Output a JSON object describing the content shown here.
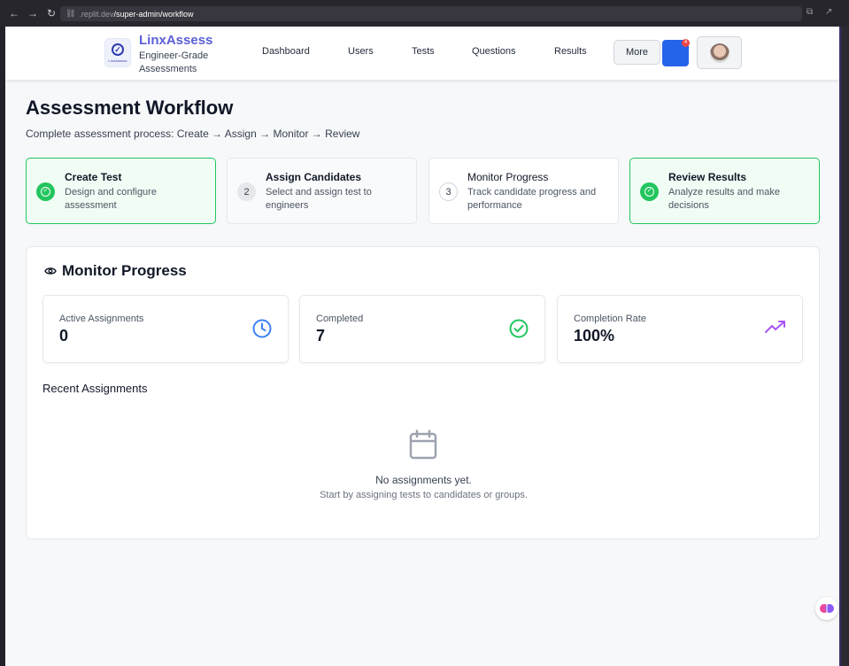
{
  "browser": {
    "url_host": ".replit.dev",
    "url_path": "/super-admin/workflow"
  },
  "header": {
    "brand_name": "LinxAssess",
    "brand_tagline": "Engineer-Grade Assessments",
    "logo_text": "LinxAssess",
    "nav": [
      "Dashboard",
      "Users",
      "Tests",
      "Questions",
      "Results"
    ],
    "more_label": "More",
    "notification_count": "4"
  },
  "page": {
    "title": "Assessment Workflow",
    "subtitle": "Complete assessment process: Create → Assign → Monitor → Review"
  },
  "steps": [
    {
      "title": "Create Test",
      "description": "Design and configure assessment",
      "status": "complete"
    },
    {
      "number": "2",
      "title": "Assign Candidates",
      "description": "Select and assign test to engineers",
      "status": "pending"
    },
    {
      "number": "3",
      "title": "Monitor Progress",
      "description": "Track candidate progress and performance",
      "status": "current"
    },
    {
      "title": "Review Results",
      "description": "Analyze results and make decisions",
      "status": "complete"
    }
  ],
  "monitor": {
    "title": "Monitor Progress",
    "stats": [
      {
        "label": "Active Assignments",
        "value": "0",
        "icon": "clock-icon",
        "color": "#3b82f6"
      },
      {
        "label": "Completed",
        "value": "7",
        "icon": "check-circle-icon",
        "color": "#22c55e"
      },
      {
        "label": "Completion Rate",
        "value": "100%",
        "icon": "trending-up-icon",
        "color": "#a855f7"
      }
    ],
    "recent_title": "Recent Assignments",
    "empty_title": "No assignments yet.",
    "empty_subtitle": "Start by assigning tests to candidates or groups."
  },
  "colors": {
    "brand": "#5b5fd6",
    "success": "#22c55e",
    "primary": "#2563eb"
  }
}
